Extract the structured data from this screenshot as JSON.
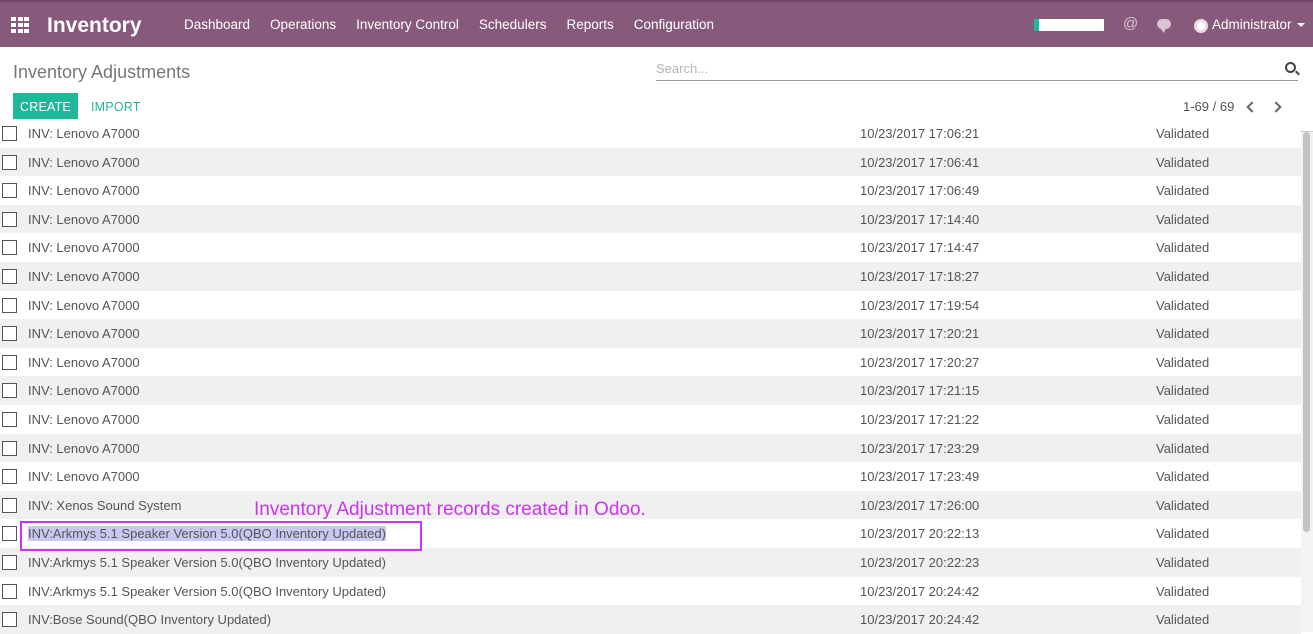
{
  "navbar": {
    "brand": "Inventory",
    "menu": [
      "Dashboard",
      "Operations",
      "Inventory Control",
      "Schedulers",
      "Reports",
      "Configuration"
    ],
    "user": "Administrator",
    "accent_color": "#875a7b"
  },
  "control_panel": {
    "title": "Inventory Adjustments",
    "search_placeholder": "Search...",
    "create_label": "CREATE",
    "import_label": "IMPORT",
    "pager": "1-69 / 69",
    "primary_color": "#21b799"
  },
  "rows": [
    {
      "ref": "INV: Lenovo A7000",
      "date": "10/23/2017 17:06:21",
      "state": "Validated"
    },
    {
      "ref": "INV: Lenovo A7000",
      "date": "10/23/2017 17:06:41",
      "state": "Validated"
    },
    {
      "ref": "INV: Lenovo A7000",
      "date": "10/23/2017 17:06:49",
      "state": "Validated"
    },
    {
      "ref": "INV: Lenovo A7000",
      "date": "10/23/2017 17:14:40",
      "state": "Validated"
    },
    {
      "ref": "INV: Lenovo A7000",
      "date": "10/23/2017 17:14:47",
      "state": "Validated"
    },
    {
      "ref": "INV: Lenovo A7000",
      "date": "10/23/2017 17:18:27",
      "state": "Validated"
    },
    {
      "ref": "INV: Lenovo A7000",
      "date": "10/23/2017 17:19:54",
      "state": "Validated"
    },
    {
      "ref": "INV: Lenovo A7000",
      "date": "10/23/2017 17:20:21",
      "state": "Validated"
    },
    {
      "ref": "INV: Lenovo A7000",
      "date": "10/23/2017 17:20:27",
      "state": "Validated"
    },
    {
      "ref": "INV: Lenovo A7000",
      "date": "10/23/2017 17:21:15",
      "state": "Validated"
    },
    {
      "ref": "INV: Lenovo A7000",
      "date": "10/23/2017 17:21:22",
      "state": "Validated"
    },
    {
      "ref": "INV: Lenovo A7000",
      "date": "10/23/2017 17:23:29",
      "state": "Validated"
    },
    {
      "ref": "INV: Lenovo A7000",
      "date": "10/23/2017 17:23:49",
      "state": "Validated"
    },
    {
      "ref": "INV: Xenos Sound System",
      "date": "10/23/2017 17:26:00",
      "state": "Validated"
    },
    {
      "ref": "INV:Arkmys 5.1 Speaker Version 5.0(QBO Inventory Updated)",
      "date": "10/23/2017 20:22:13",
      "state": "Validated"
    },
    {
      "ref": "INV:Arkmys 5.1 Speaker Version 5.0(QBO Inventory Updated)",
      "date": "10/23/2017 20:22:23",
      "state": "Validated"
    },
    {
      "ref": "INV:Arkmys 5.1 Speaker Version 5.0(QBO Inventory Updated)",
      "date": "10/23/2017 20:24:42",
      "state": "Validated"
    },
    {
      "ref": "INV:Bose Sound(QBO Inventory Updated)",
      "date": "10/23/2017 20:24:42",
      "state": "Validated"
    }
  ],
  "annotation": {
    "text": "Inventory Adjustment records created in Odoo.",
    "color": "#cc33ee"
  }
}
